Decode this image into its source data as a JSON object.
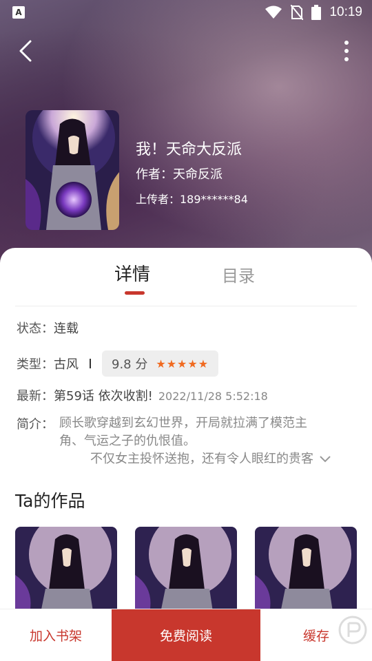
{
  "status_bar": {
    "time": "10:19",
    "icons": [
      "accessibility-icon",
      "wifi-icon",
      "no-sim-icon",
      "battery-icon"
    ]
  },
  "nav": {
    "back_icon": "chevron-left-icon",
    "more_icon": "more-vertical-icon"
  },
  "book": {
    "title": "我！天命大反派",
    "author": "作者：天命反派",
    "uploader": "上传者：189******84"
  },
  "tabs": [
    {
      "label": "详情",
      "active": true
    },
    {
      "label": "目录",
      "active": false
    }
  ],
  "details": {
    "status_label": "状态：",
    "status_value": "连载",
    "type_label": "类型：",
    "type_value": "古风",
    "score": "9.8 分",
    "stars": "★★★★★",
    "latest_label": "最新：",
    "latest_chapter": "第59话 依次收割!",
    "latest_time": "2022/11/28 5:52:18",
    "intro_label": "简介：",
    "intro_line1": "顾长歌穿越到玄幻世界，开局就拉满了模范主",
    "intro_line2": "角、气运之子的仇恨值。",
    "intro_line3": "不仅女主投怀送抱，还有令人眼红的贵客"
  },
  "works": {
    "title": "Ta的作品",
    "count": 3
  },
  "bottom_bar": {
    "shelf": "加入书架",
    "read": "免费阅读",
    "cache": "缓存"
  },
  "colors": {
    "accent": "#c8372d",
    "star": "#f06a20"
  }
}
